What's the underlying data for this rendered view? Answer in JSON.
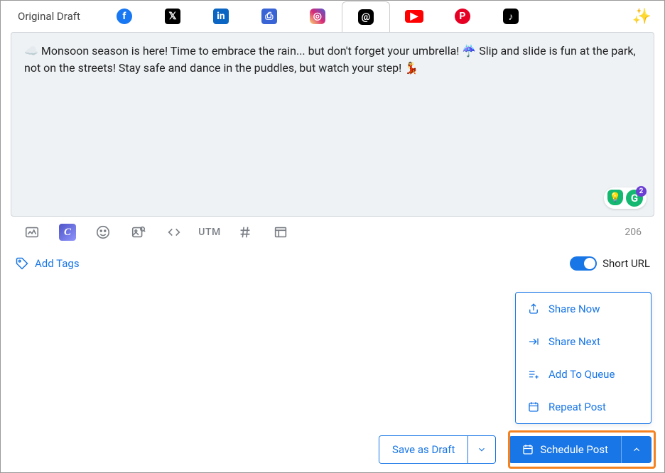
{
  "header": {
    "original_label": "Original Draft",
    "platforms": [
      {
        "name": "facebook",
        "glyph": "f"
      },
      {
        "name": "x-twitter",
        "glyph": "𝕏"
      },
      {
        "name": "linkedin",
        "glyph": "in"
      },
      {
        "name": "gmb",
        "glyph": "⎙"
      },
      {
        "name": "instagram",
        "glyph": "◎"
      },
      {
        "name": "threads",
        "glyph": "@",
        "active": true
      },
      {
        "name": "youtube",
        "glyph": "▶"
      },
      {
        "name": "pinterest",
        "glyph": "P"
      },
      {
        "name": "tiktok",
        "glyph": "♪"
      }
    ],
    "sparkle": "✨"
  },
  "editor": {
    "content": "☁️ Monsoon season is here! Time to embrace the rain... but don't forget your umbrella! ☔ Slip and slide is fun at the park, not on the streets! Stay safe and dance in the puddles, but watch your step! 💃",
    "char_count": "206",
    "grammarly_count": "2"
  },
  "toolbar": {
    "utm_label": "UTM"
  },
  "tags": {
    "add_tags_label": "Add Tags",
    "short_url_label": "Short URL"
  },
  "menu": {
    "items": [
      {
        "key": "share-now",
        "label": "Share Now"
      },
      {
        "key": "share-next",
        "label": "Share Next"
      },
      {
        "key": "add-queue",
        "label": "Add To Queue"
      },
      {
        "key": "repeat",
        "label": "Repeat Post"
      }
    ]
  },
  "buttons": {
    "save_draft": "Save as Draft",
    "schedule": "Schedule Post"
  }
}
